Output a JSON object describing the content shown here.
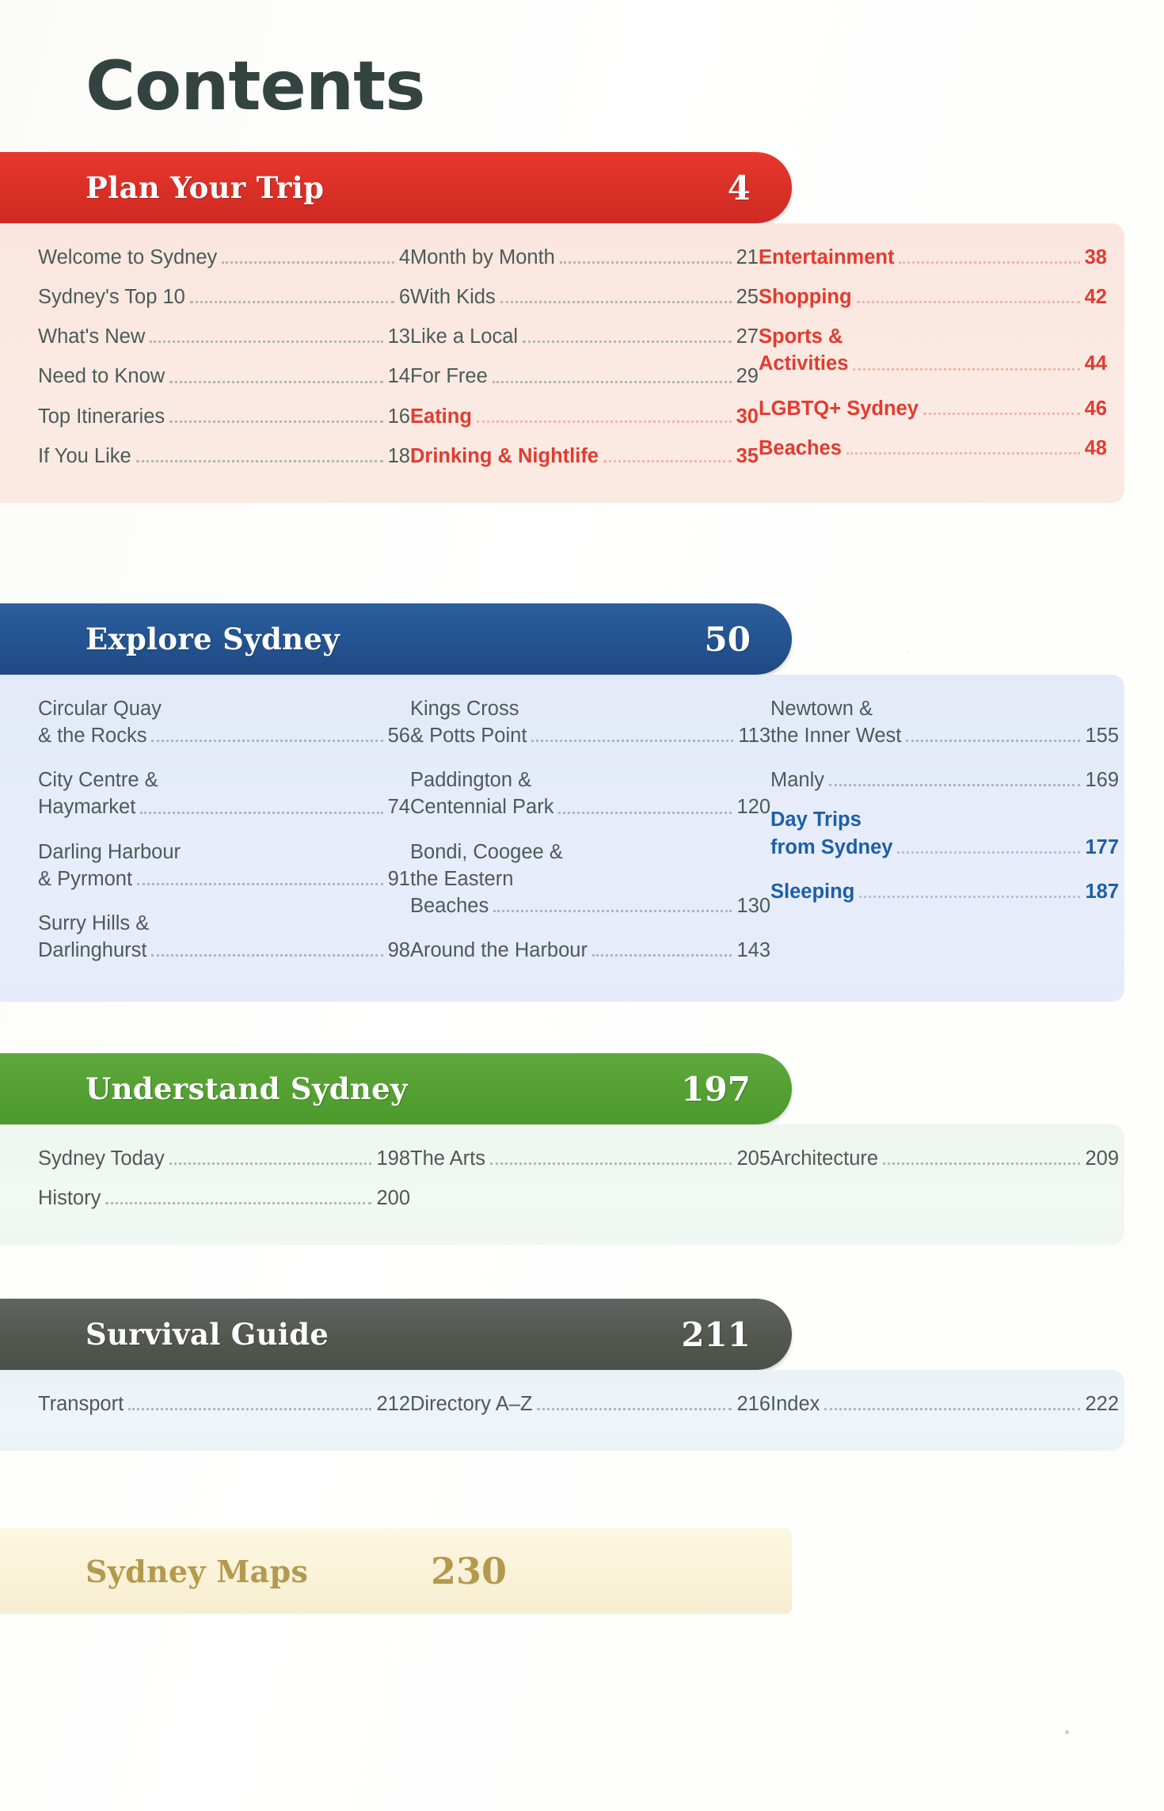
{
  "page_title": "Contents",
  "sections": [
    {
      "id": "plan",
      "title": "Plan Your Trip",
      "page": "4",
      "accent": "#e23b30",
      "columns": [
        [
          {
            "label": "Welcome to Sydney",
            "page": "4"
          },
          {
            "label": "Sydney's Top 10",
            "page": "6"
          },
          {
            "label": "What's New",
            "page": "13"
          },
          {
            "label": "Need to Know",
            "page": "14"
          },
          {
            "label": "Top Itineraries",
            "page": "16"
          },
          {
            "label": "If You Like",
            "page": "18"
          }
        ],
        [
          {
            "label": "Month by Month",
            "page": "21"
          },
          {
            "label": "With Kids",
            "page": "25"
          },
          {
            "label": "Like a Local",
            "page": "27"
          },
          {
            "label": "For Free",
            "page": "29"
          },
          {
            "label": "Eating",
            "page": "30",
            "highlight": true
          },
          {
            "label": "Drinking & Nightlife",
            "page": "35",
            "highlight": true
          }
        ],
        [
          {
            "label": "Entertainment",
            "page": "38",
            "highlight": true
          },
          {
            "label": "Shopping",
            "page": "42",
            "highlight": true
          },
          {
            "label": "Sports &",
            "label2": "Activities",
            "page": "44",
            "highlight": true
          },
          {
            "label": "LGBTQ+ Sydney",
            "page": "46",
            "highlight": true
          },
          {
            "label": "Beaches",
            "page": "48",
            "highlight": true
          }
        ]
      ]
    },
    {
      "id": "explore",
      "title": "Explore Sydney",
      "page": "50",
      "accent": "#1d5fa8",
      "columns": [
        [
          {
            "label": "Circular Quay",
            "label2": "& the Rocks",
            "page": "56"
          },
          {
            "label": "City Centre &",
            "label2": "Haymarket",
            "page": "74"
          },
          {
            "label": "Darling Harbour",
            "label2": "& Pyrmont",
            "page": "91"
          },
          {
            "label": "Surry Hills &",
            "label2": "Darlinghurst",
            "page": "98"
          }
        ],
        [
          {
            "label": "Kings Cross",
            "label2": "& Potts Point",
            "page": "113"
          },
          {
            "label": "Paddington &",
            "label2": "Centennial Park",
            "page": "120"
          },
          {
            "label": "Bondi, Coogee &",
            "label2": "the Eastern",
            "label3": "Beaches",
            "page": "130"
          },
          {
            "label": "Around the Harbour",
            "page": "143"
          }
        ],
        [
          {
            "label": "Newtown &",
            "label2": "the Inner West",
            "page": "155"
          },
          {
            "label": "Manly",
            "page": "169"
          },
          {
            "label": "Day Trips",
            "label2": "from Sydney",
            "page": "177",
            "highlight": true
          },
          {
            "label": "Sleeping",
            "page": "187",
            "highlight": true
          }
        ]
      ]
    },
    {
      "id": "understand",
      "title": "Understand Sydney",
      "page": "197",
      "accent": "#4c9a2c",
      "columns": [
        [
          {
            "label": "Sydney Today",
            "page": "198"
          },
          {
            "label": "History",
            "page": "200"
          }
        ],
        [
          {
            "label": "The Arts",
            "page": "205"
          }
        ],
        [
          {
            "label": "Architecture",
            "page": "209"
          }
        ]
      ]
    },
    {
      "id": "survival",
      "title": "Survival Guide",
      "page": "211",
      "accent": "#4b5048",
      "columns": [
        [
          {
            "label": "Transport",
            "page": "212"
          }
        ],
        [
          {
            "label": "Directory A–Z",
            "page": "216"
          }
        ],
        [
          {
            "label": "Index",
            "page": "222"
          }
        ]
      ]
    },
    {
      "id": "maps",
      "title": "Sydney Maps",
      "page": "230",
      "accent": "#b49a4e",
      "columns": []
    }
  ]
}
